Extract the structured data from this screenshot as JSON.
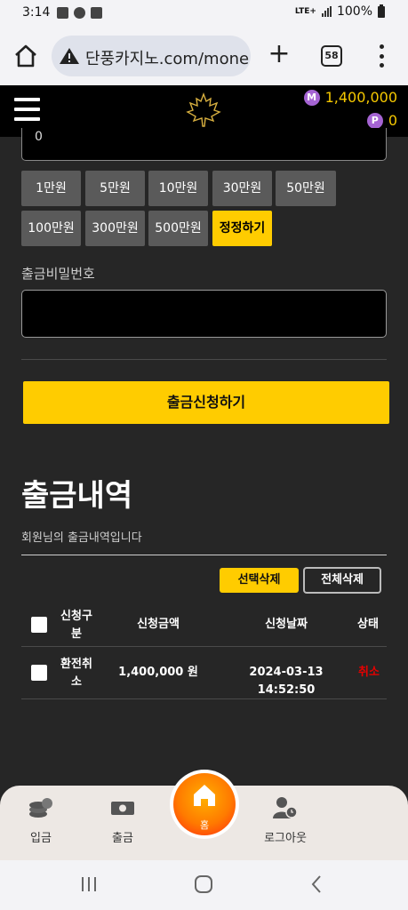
{
  "status_bar": {
    "time": "3:14",
    "network": "LTE+",
    "battery": "100%"
  },
  "browser": {
    "url": "단풍카지노.com/mone",
    "tab_count": "58"
  },
  "header": {
    "money_icon": "M",
    "money_balance": "1,400,000",
    "point_icon": "P",
    "point_balance": "0"
  },
  "form": {
    "amount_value": "0",
    "amount_buttons": [
      "1만원",
      "5만원",
      "10만원",
      "30만원",
      "50만원",
      "100만원",
      "300만원",
      "500만원"
    ],
    "reset_label": "정정하기",
    "password_label": "출금비밀번호",
    "password_value": "",
    "submit_label": "출금신청하기"
  },
  "history": {
    "title": "출금내역",
    "subtitle": "회원님의 출금내역입니다",
    "delete_selected_label": "선택삭제",
    "delete_all_label": "전체삭제",
    "columns": {
      "type_l1": "신청구",
      "type_l2": "분",
      "amount": "신청금액",
      "date": "신청날짜",
      "status": "상태"
    },
    "rows": [
      {
        "type_l1": "환전취",
        "type_l2": "소",
        "amount": "1,400,000 원",
        "date": "2024-03-13 14:52:50",
        "status": "취소"
      }
    ]
  },
  "bottom_nav": {
    "deposit": "입금",
    "withdraw": "출금",
    "home": "홈",
    "logout": "로그아웃"
  },
  "colors": {
    "accent": "#ffcc00",
    "background": "#262626",
    "cancel": "#e60000",
    "coin": "#a564d3"
  }
}
